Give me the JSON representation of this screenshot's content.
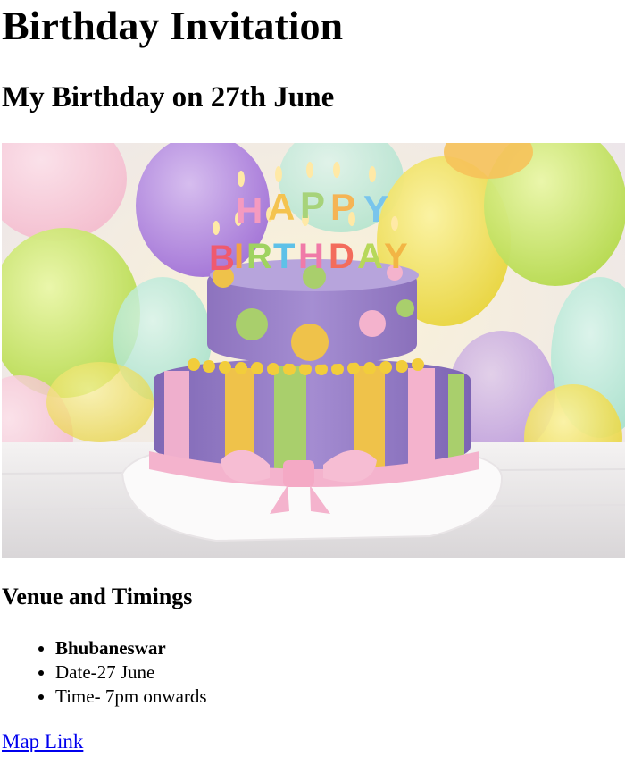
{
  "page": {
    "title": "Birthday Invitation",
    "subtitle": "My Birthday on 27th June"
  },
  "image": {
    "icon": "birthday-cake-photo",
    "candle_letters_top": "HAPPY",
    "candle_letters_bottom": "BIRTHDAY",
    "colors": {
      "cake_purple": "#9d84c9",
      "ribbon_pink": "#f4b3cd",
      "stripe_yellow": "#efc24a",
      "stripe_green": "#a9cf6c"
    }
  },
  "venue": {
    "heading": "Venue and Timings",
    "items": [
      "Bhubaneswar",
      "Date-27 June",
      "Time- 7pm onwards"
    ]
  },
  "map_link": {
    "label": "Map Link",
    "color": "#0000ee"
  }
}
